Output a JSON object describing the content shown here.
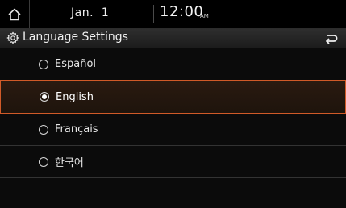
{
  "status_bar": {
    "date": "Jan.  1",
    "time": "12:00",
    "ampm": "AM"
  },
  "header": {
    "title": "Language Settings",
    "icon": "gear-icon",
    "back_icon": "back-arrow-icon"
  },
  "languages": [
    {
      "label": "Español",
      "selected": false
    },
    {
      "label": "English",
      "selected": true
    },
    {
      "label": "Français",
      "selected": false
    },
    {
      "label": "한국어",
      "selected": false
    }
  ],
  "colors": {
    "accent": "#d05a28"
  }
}
